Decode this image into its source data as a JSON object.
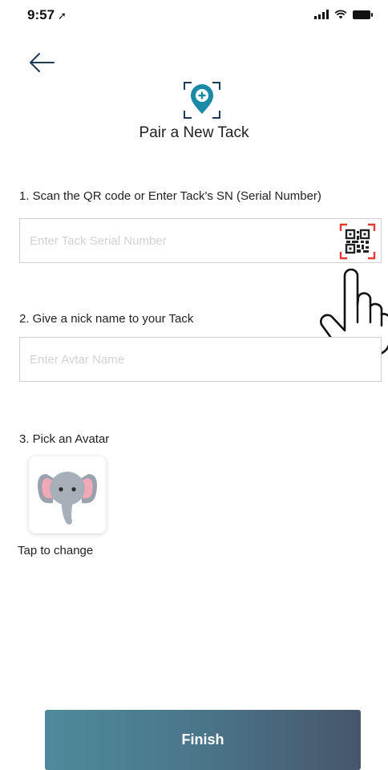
{
  "status_bar": {
    "time": "9:57"
  },
  "header": {
    "title": "Pair a New Tack"
  },
  "step1": {
    "label": "1. Scan the QR code or Enter Tack's SN (Serial Number)",
    "placeholder": "Enter Tack Serial Number"
  },
  "step2": {
    "label": "2. Give a nick name to your Tack",
    "placeholder": "Enter Avtar Name"
  },
  "step3": {
    "label": "3. Pick an Avatar",
    "change_label": "Tap to change"
  },
  "footer": {
    "finish_label": "Finish"
  },
  "icons": [
    "back-arrow-icon",
    "location-pin-add-icon",
    "qr-code-scan-icon",
    "pointing-hand-icon",
    "elephant-avatar-icon"
  ],
  "colors": {
    "accent": "#1b8aa6",
    "qr_corner": "#e53935",
    "button_start": "#4f8a9c",
    "button_end": "#47566b"
  }
}
